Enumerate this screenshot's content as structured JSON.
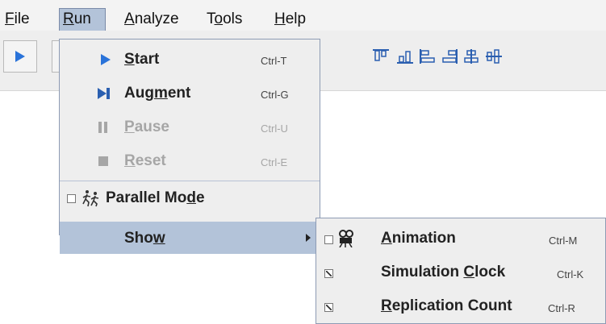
{
  "menubar": {
    "items": [
      {
        "pre": "",
        "u": "F",
        "post": "ile"
      },
      {
        "pre": "",
        "u": "R",
        "post": "un"
      },
      {
        "pre": "",
        "u": "A",
        "post": "nalyze"
      },
      {
        "pre": "T",
        "u": "o",
        "post": "ols"
      },
      {
        "pre": "",
        "u": "H",
        "post": "elp"
      }
    ]
  },
  "run_menu": {
    "items": [
      {
        "pre": "",
        "u": "S",
        "post": "tart",
        "accel": "Ctrl-T",
        "enabled": true,
        "icon": "play-icon"
      },
      {
        "pre": "Aug",
        "u": "m",
        "post": "ent",
        "accel": "Ctrl-G",
        "enabled": true,
        "icon": "step-forward-icon"
      },
      {
        "pre": "",
        "u": "P",
        "post": "ause",
        "accel": "Ctrl-U",
        "enabled": false,
        "icon": "pause-icon"
      },
      {
        "pre": "",
        "u": "R",
        "post": "eset",
        "accel": "Ctrl-E",
        "enabled": false,
        "icon": "stop-icon"
      }
    ],
    "parallel": {
      "pre": "Parallel Mo",
      "u": "d",
      "post": "e",
      "checked": false,
      "icon": "runner-icon"
    },
    "show": {
      "pre": "Sho",
      "u": "w",
      "post": "",
      "icon": "submenu-arrow-icon"
    }
  },
  "show_submenu": {
    "items": [
      {
        "pre": "",
        "u": "A",
        "post": "nimation",
        "accel": "Ctrl-M",
        "checked": false,
        "icon": "projector-icon"
      },
      {
        "pre": "Simulation ",
        "u": "C",
        "post": "lock",
        "accel": "Ctrl-K",
        "checked": true
      },
      {
        "pre": "",
        "u": "R",
        "post": "eplication Count",
        "accel": "Ctrl-R",
        "checked": true
      }
    ]
  },
  "colors": {
    "menu_bg": "#eeeeee",
    "highlight": "#b3c3d9",
    "play_blue": "#2a73d9",
    "disabled": "#a6a6a6"
  }
}
